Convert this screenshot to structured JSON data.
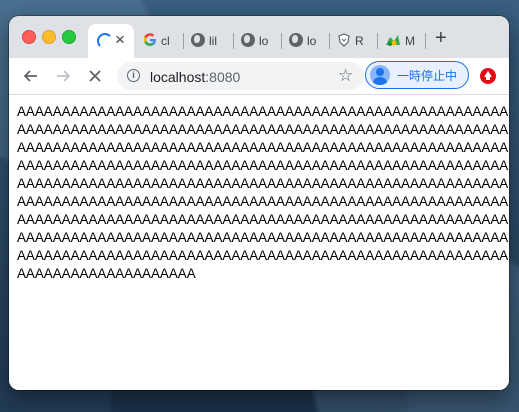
{
  "window": {
    "controls": [
      "close",
      "minimize",
      "maximize"
    ]
  },
  "tabs": [
    {
      "title": "",
      "state": "loading",
      "favicon": "spinner-icon",
      "close_label": "×",
      "active": true
    },
    {
      "title": "cl",
      "favicon": "google-icon"
    },
    {
      "title": "lil",
      "favicon": "globe-icon"
    },
    {
      "title": "lo",
      "favicon": "globe-icon"
    },
    {
      "title": "lo",
      "favicon": "globe-icon"
    },
    {
      "title": "R",
      "favicon": "shield-icon"
    },
    {
      "title": "M",
      "favicon": "green-app-icon"
    }
  ],
  "new_tab_label": "+",
  "toolbar": {
    "back_icon": "back-arrow-icon",
    "forward_icon": "forward-arrow-icon",
    "stop_icon": "stop-icon",
    "url_host": "localhost",
    "url_port": ":8080",
    "info_icon": "i",
    "star_icon": "☆",
    "profile_label": "一時停止中",
    "extension_icon": "upload-icon"
  },
  "colors": {
    "tabstrip_bg": "#dee1e6",
    "accent": "#1a73e8",
    "close": "#fe5f57",
    "minimize": "#febc2e",
    "maximize": "#28c840",
    "extension": "#e50914"
  },
  "page": {
    "text": "AAAAAAAAAAAAAAAAAAAAAAAAAAAAAAAAAAAAAAAAAAAAAAAAAAAAAAAAAAAAAAAAAAAAAAAAAAAAAAAAAAAAAAAAAAAAAAAAAAAAAAAAAAAAAAAAAAAAAAAAAAAAAAAAAAAAAAAAAAAAAAAAAAAAAAAAAAAAAAAAAAAAAAAAAAAAAAAAAAAAAAAAAAAAAAAAAAAAAAAAAAAAAAAAAAAAAAAAAAAAAAAAAAAAAAAAAAAAAAAAAAAAAAAAAAAAAAAAAAAAAAAAAAAAAAAAAAAAAAAAAAAAAAAAAAAAAAAAAAAAAAAAAAAAAAAAAAAAAAAAAAAAAAAAAAAAAAAAAAAAAAAAAAAAAAAAAAAAAAAAAAAAAAAAAAAAAAAAAAAAAAAAAAAAAAAAAAAAAAAAAAAAAAAAAAAAAAAAAAAAAAAAAAAAAAAAAAAAAAAAAAAAAAAAAAAAAAAAAAAAAAAAAAAAAAAAAAAAAAAAAAAAAAAAAAAAAAAAAAAAAAAAAAAAAAAAAAA"
  }
}
